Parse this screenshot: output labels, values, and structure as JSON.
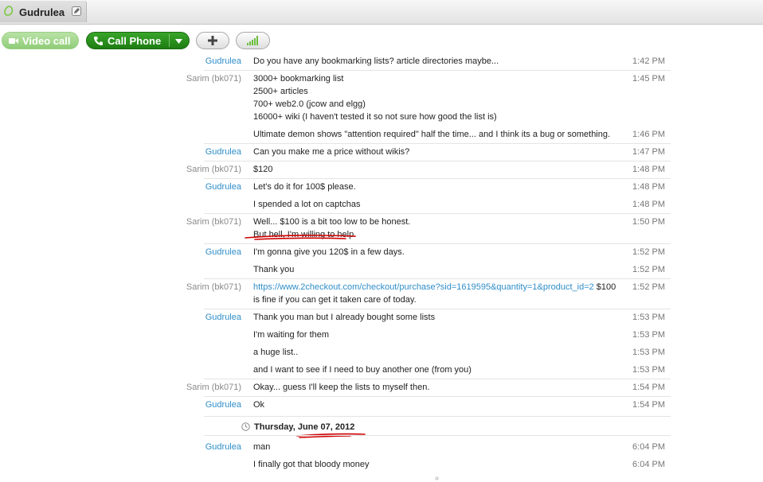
{
  "window": {
    "tab_title": "Gudrulea"
  },
  "toolbar": {
    "video_call_label": "Video call",
    "call_phone_label": "Call Phone"
  },
  "chat": {
    "messages": [
      {
        "sender": "Gudrulea",
        "lines": [
          "Do you have any bookmarking lists? article directories maybe..."
        ],
        "time": "1:42 PM"
      },
      {
        "sender": "Sarim (bk071)",
        "lines": [
          "3000+ bookmarking list",
          "2500+ articles",
          "700+ web2.0 (jcow and elgg)",
          "16000+ wiki (I haven't tested it so not sure how good the list is)"
        ],
        "time": "1:45 PM"
      },
      {
        "sender": "",
        "lines": [
          "Ultimate demon shows \"attention required\" half the time... and I think its a bug or something."
        ],
        "time": "1:46 PM"
      },
      {
        "sender": "Gudrulea",
        "lines": [
          "Can you make me a price without wikis?"
        ],
        "time": "1:47 PM"
      },
      {
        "sender": "Sarim (bk071)",
        "lines": [
          "$120"
        ],
        "time": "1:48 PM"
      },
      {
        "sender": "Gudrulea",
        "lines": [
          "Let's do it for 100$ please."
        ],
        "time": "1:48 PM"
      },
      {
        "sender": "",
        "lines": [
          "I spended a lot on captchas"
        ],
        "time": "1:48 PM"
      },
      {
        "sender": "Sarim (bk071)",
        "lines": [
          "Well... $100 is a bit too low to be honest.",
          "But hell, I'm willing to help."
        ],
        "time": "1:50 PM"
      },
      {
        "sender": "Gudrulea",
        "lines": [
          "I'm gonna give you 120$ in a few days."
        ],
        "time": "1:52 PM"
      },
      {
        "sender": "",
        "lines": [
          "Thank you"
        ],
        "time": "1:52 PM"
      },
      {
        "sender": "Sarim (bk071)",
        "link": "https://www.2checkout.com/checkout/purchase?sid=1619595&quantity=1&product_id=2",
        "link_suffix": " $100",
        "lines": [
          "is fine if you can get it taken care of today."
        ],
        "time": "1:52 PM"
      },
      {
        "sender": "Gudrulea",
        "lines": [
          "Thank you man but I already bought some lists"
        ],
        "time": "1:53 PM"
      },
      {
        "sender": "",
        "lines": [
          "I'm waiting for them"
        ],
        "time": "1:53 PM"
      },
      {
        "sender": "",
        "lines": [
          "a huge list.."
        ],
        "time": "1:53 PM"
      },
      {
        "sender": "",
        "lines": [
          "and I want to see if I need to buy another one (from you)"
        ],
        "time": "1:53 PM"
      },
      {
        "sender": "Sarim (bk071)",
        "lines": [
          "Okay... guess I'll keep the lists to myself then."
        ],
        "time": "1:54 PM"
      },
      {
        "sender": "Gudrulea",
        "lines": [
          "Ok"
        ],
        "time": "1:54 PM"
      },
      {
        "sender": "Gudrulea",
        "lines": [
          "man"
        ],
        "time": "6:04 PM"
      },
      {
        "sender": "",
        "lines": [
          "I finally got that bloody money"
        ],
        "time": "6:04 PM"
      }
    ],
    "date_separator": {
      "weekday": "Thursday,",
      "date": "June 07, 2012"
    }
  },
  "colors": {
    "accent_blue": "#2f8ec8",
    "call_green": "#2a9020",
    "underline_red": "#d00000"
  }
}
